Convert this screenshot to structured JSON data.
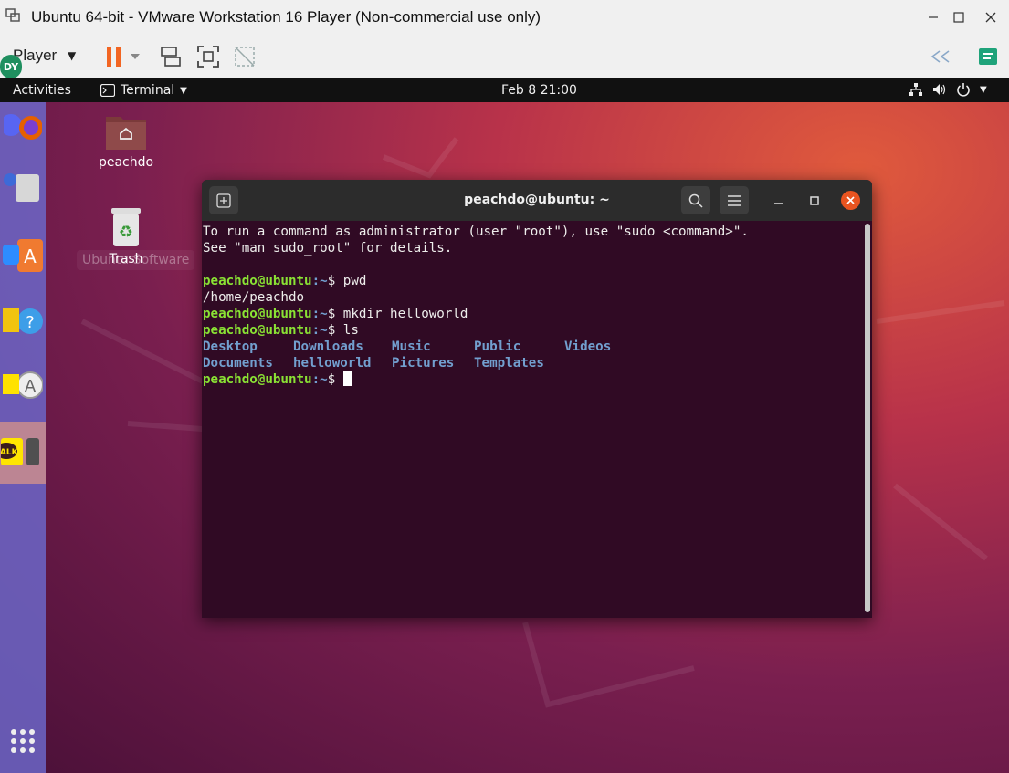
{
  "vmware": {
    "title": "Ubuntu 64-bit - VMware Workstation 16 Player (Non-commercial use only)",
    "toolbar_label": "Player",
    "accent_color": "#f26522"
  },
  "topbar": {
    "activities": "Activities",
    "app_menu": "Terminal",
    "clock": "Feb 8  21:00"
  },
  "desktop": {
    "icons": [
      {
        "label": "peachdo"
      },
      {
        "label": "Trash"
      }
    ],
    "tooltip": "Ubuntu Software"
  },
  "terminal": {
    "title": "peachdo@ubuntu: ~",
    "intro_line1": "To run a command as administrator (user \"root\"), use \"sudo <command>\".",
    "intro_line2": "See \"man sudo_root\" for details.",
    "prompt_user": "peachdo@ubuntu",
    "prompt_path": ":~",
    "prompt_sign": "$",
    "cmd1": " pwd",
    "out1": "/home/peachdo",
    "cmd2": " mkdir helloworld",
    "cmd3": " ls",
    "ls_row1": [
      "Desktop",
      "Downloads",
      "Music",
      "Public",
      "Videos"
    ],
    "ls_row2": [
      "Documents",
      "helloworld",
      "Pictures",
      "Templates"
    ]
  },
  "dock": {
    "badge": "DY",
    "talk": "TALK"
  }
}
